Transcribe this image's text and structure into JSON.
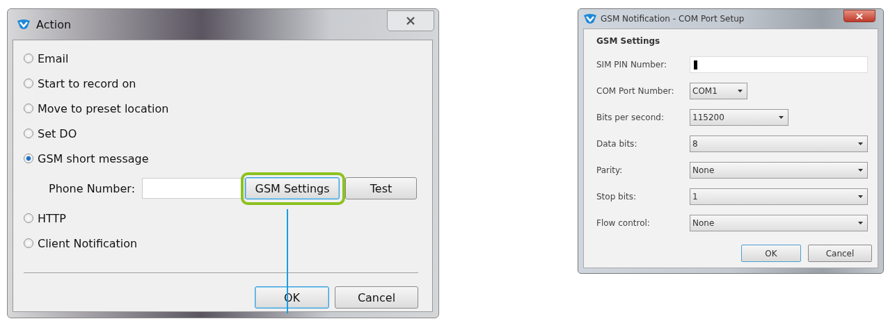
{
  "action_dialog": {
    "title": "Action",
    "options": [
      {
        "label": "Email",
        "selected": false
      },
      {
        "label": "Start to record on",
        "selected": false
      },
      {
        "label": "Move to preset location",
        "selected": false
      },
      {
        "label": "Set DO",
        "selected": false
      },
      {
        "label": "GSM short message",
        "selected": true
      },
      {
        "label": "HTTP",
        "selected": false
      },
      {
        "label": "Client Notification",
        "selected": false
      }
    ],
    "phone_number": {
      "label": "Phone Number:"
    },
    "phone_buttons": [
      {
        "label": "GSM Settings",
        "focused": true,
        "highlighted": true
      },
      {
        "label": "Test",
        "focused": false,
        "highlighted": false
      }
    ],
    "buttons": [
      {
        "label": "OK",
        "focused": true
      },
      {
        "label": "Cancel",
        "focused": false
      }
    ]
  },
  "settings_dialog": {
    "title": "GSM Notification - COM Port Setup",
    "section": "GSM Settings",
    "fields": [
      {
        "kind": "text",
        "label": "SIM PIN Number:",
        "focused": true
      },
      {
        "kind": "select",
        "label": "COM Port Number:",
        "value": "COM1"
      },
      {
        "kind": "select",
        "label": "Bits per second:",
        "value": "115200"
      },
      {
        "kind": "select",
        "label": "Data bits:",
        "value": "8"
      },
      {
        "kind": "select",
        "label": "Parity:",
        "value": "None"
      },
      {
        "kind": "select",
        "label": "Stop bits:",
        "value": "1"
      },
      {
        "kind": "select",
        "label": "Flow control:",
        "value": "None"
      }
    ],
    "buttons": [
      {
        "label": "OK",
        "focused": true
      },
      {
        "label": "Cancel",
        "focused": false
      }
    ]
  }
}
